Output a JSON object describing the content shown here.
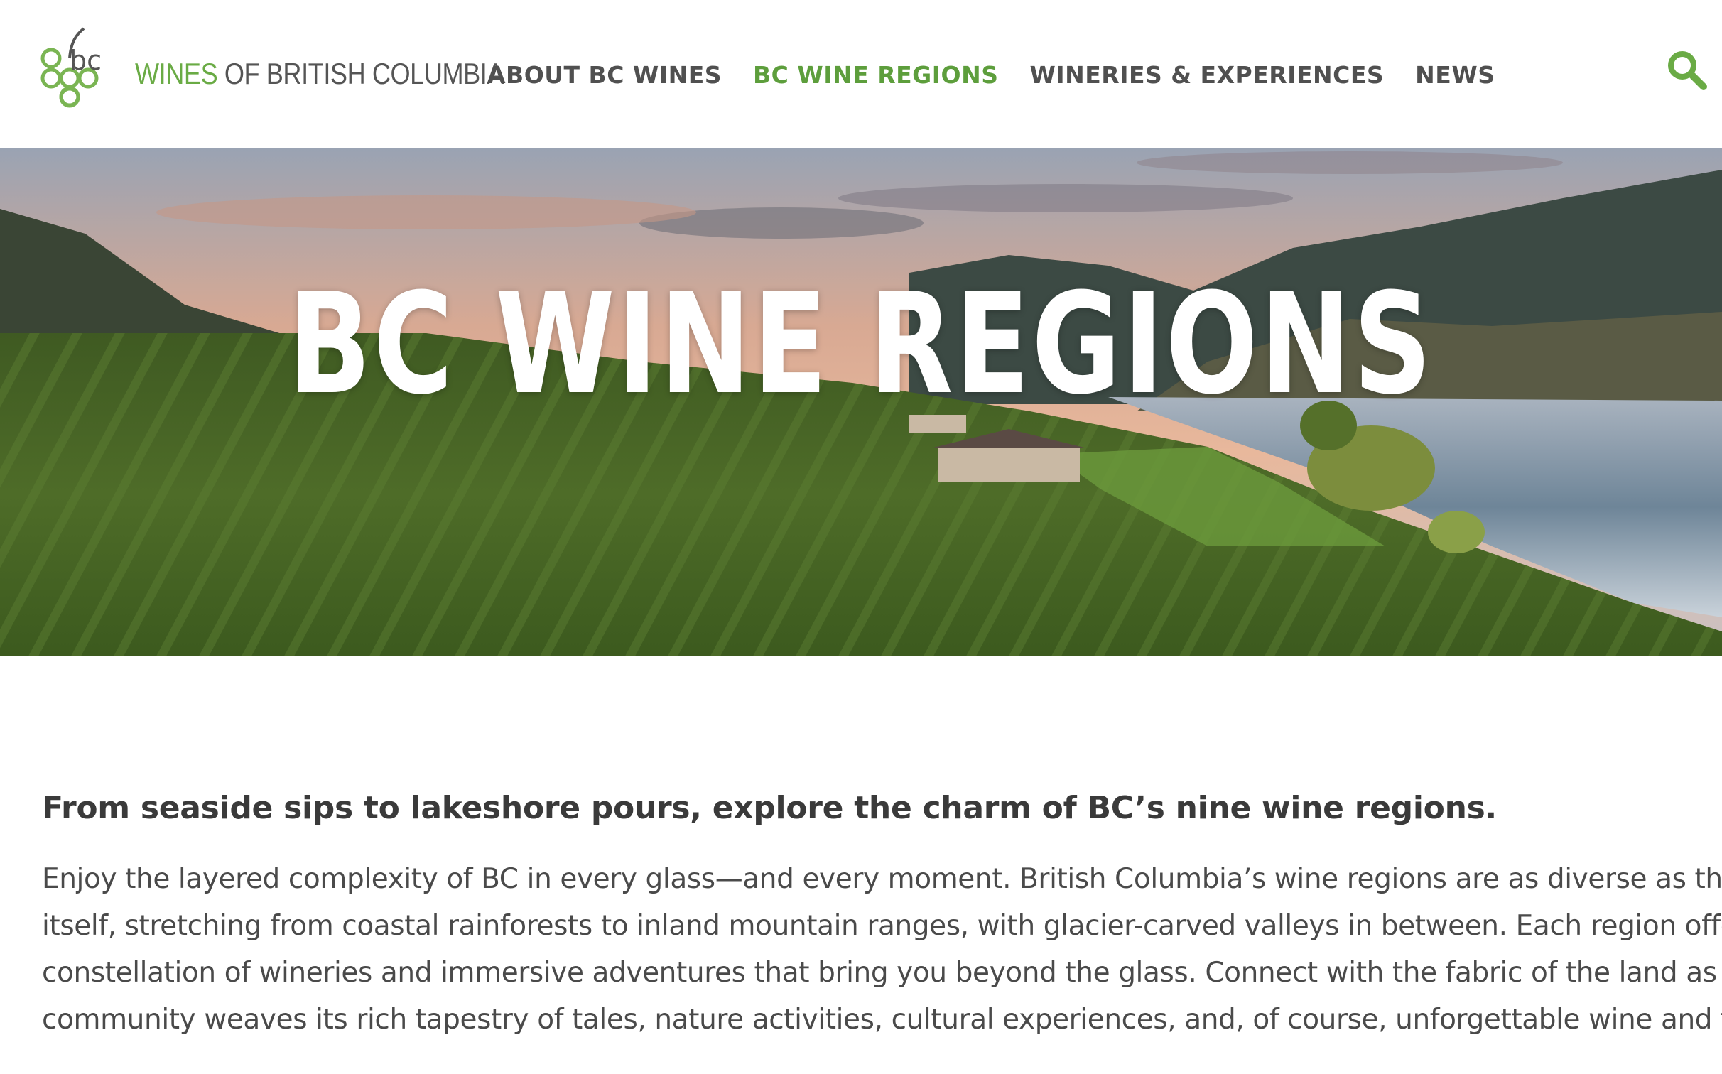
{
  "header": {
    "brand_part1": "WINES",
    "brand_part2": " OF BRITISH COLUMBIA",
    "logo_text": "bc",
    "nav": [
      {
        "label": "ABOUT BC WINES",
        "active": false
      },
      {
        "label": "BC WINE REGIONS",
        "active": true
      },
      {
        "label": "WINERIES & EXPERIENCES",
        "active": false
      },
      {
        "label": "NEWS",
        "active": false
      }
    ],
    "search_icon": "search-icon"
  },
  "hero": {
    "title": "BC WINE REGIONS"
  },
  "content": {
    "intro": "From seaside sips to lakeshore pours, explore the charm of BC’s nine wine regions.",
    "body_lines": [
      "Enjoy the layered complexity of BC in every glass—and every moment. British Columbia’s wine regions are as diverse as the land",
      "itself, stretching from coastal rainforests to inland mountain ranges, with glacier-carved valleys in between. Each region offers a",
      "constellation of wineries and immersive adventures that bring you beyond the glass. Connect with the fabric of the land as each",
      "community weaves its rich tapestry of tales, nature activities, cultural experiences, and, of course, unforgettable wine and food."
    ]
  },
  "colors": {
    "brand_green": "#6aab45",
    "nav_active": "#5d9e3c",
    "nav_default": "#505050",
    "text": "#4a4a4a"
  }
}
